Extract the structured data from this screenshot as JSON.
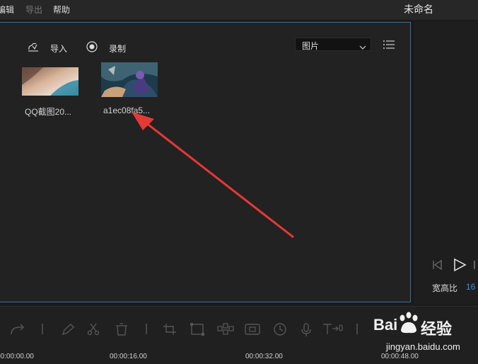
{
  "menubar": {
    "items": [
      {
        "label": "编辑",
        "enabled": true
      },
      {
        "label": "导出",
        "enabled": false
      },
      {
        "label": "帮助",
        "enabled": true
      }
    ],
    "title": "未命名"
  },
  "media": {
    "import_label": "导入",
    "record_label": "录制",
    "filter": {
      "selected": "图片"
    },
    "items": [
      {
        "name": "QQ截图20..."
      },
      {
        "name": "a1ec08fa5..."
      }
    ]
  },
  "preview": {
    "aspect_label": "宽高比",
    "aspect_value": "16"
  },
  "timeline": {
    "ticks": [
      "00:00:00.00",
      "00:00:16.00",
      "00:00:32.00",
      "00:00:48.00"
    ]
  },
  "watermark": {
    "site": "jingyan.baidu.com",
    "brand": "Bai",
    "suffix": "经验"
  },
  "colors": {
    "accent_border": "#3f6f9d",
    "arrow": "#e53935",
    "aspect_value": "#3d8fe0"
  }
}
